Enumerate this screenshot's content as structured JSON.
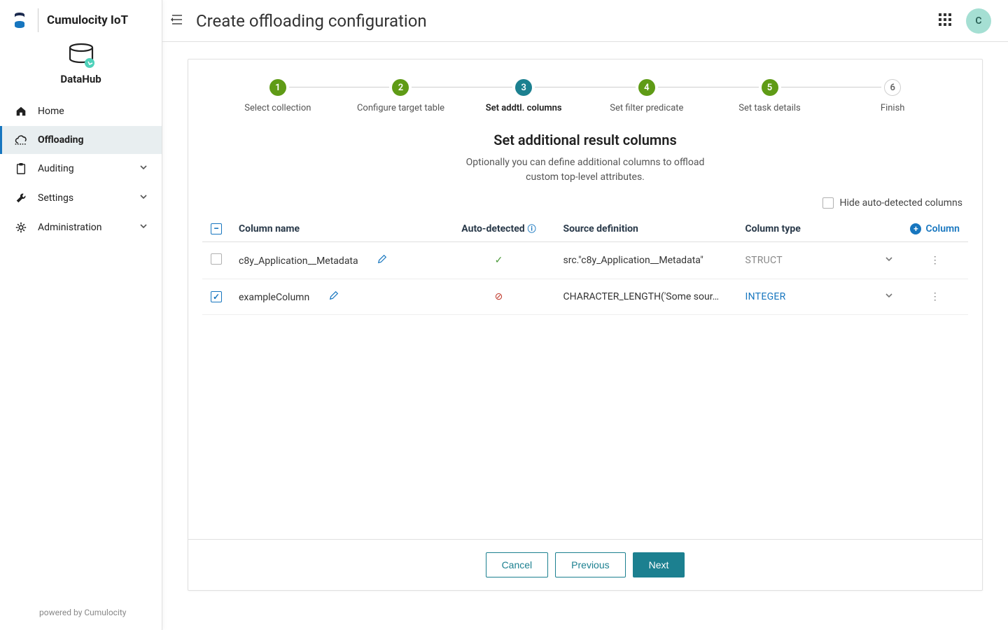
{
  "brand": {
    "product": "Cumulocity IoT",
    "module": "DataHub"
  },
  "sidebar": {
    "items": [
      {
        "label": "Home",
        "icon": "home",
        "active": false,
        "expandable": false
      },
      {
        "label": "Offloading",
        "icon": "cloud",
        "active": true,
        "expandable": false
      },
      {
        "label": "Auditing",
        "icon": "clipboard",
        "active": false,
        "expandable": true
      },
      {
        "label": "Settings",
        "icon": "wrench",
        "active": false,
        "expandable": true
      },
      {
        "label": "Administration",
        "icon": "gear",
        "active": false,
        "expandable": true
      }
    ],
    "footer": "powered by Cumulocity"
  },
  "header": {
    "title": "Create offloading configuration",
    "avatar_initial": "C"
  },
  "stepper": {
    "steps": [
      {
        "num": "1",
        "label": "Select collection",
        "state": "done"
      },
      {
        "num": "2",
        "label": "Configure target table",
        "state": "done"
      },
      {
        "num": "3",
        "label": "Set addtl. columns",
        "state": "current"
      },
      {
        "num": "4",
        "label": "Set filter predicate",
        "state": "done"
      },
      {
        "num": "5",
        "label": "Set task details",
        "state": "done"
      },
      {
        "num": "6",
        "label": "Finish",
        "state": "pending"
      }
    ]
  },
  "section": {
    "title": "Set additional result columns",
    "description_line1": "Optionally you can define additional columns to offload",
    "description_line2": "custom top-level attributes."
  },
  "controls": {
    "hide_auto_label": "Hide auto-detected columns"
  },
  "table": {
    "headers": {
      "column_name": "Column name",
      "auto_detected": "Auto-detected",
      "source_definition": "Source definition",
      "column_type": "Column type",
      "add_column": "Column"
    },
    "rows": [
      {
        "checked": false,
        "name": "c8y_Application__Metadata",
        "auto": true,
        "source": "src.\"c8y_Application__Metadata\"",
        "type": "STRUCT"
      },
      {
        "checked": true,
        "name": "exampleColumn",
        "auto": false,
        "source": "CHARACTER_LENGTH('Some sour…",
        "type": "INTEGER"
      }
    ]
  },
  "footer": {
    "cancel": "Cancel",
    "previous": "Previous",
    "next": "Next"
  }
}
